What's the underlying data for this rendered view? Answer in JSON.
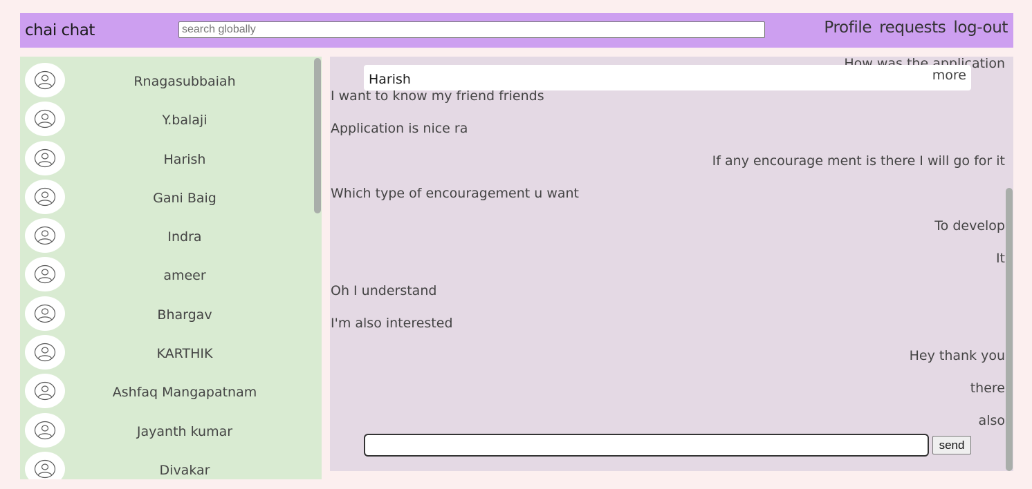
{
  "header": {
    "title": "chai chat",
    "search_placeholder": "search globally",
    "nav": [
      "Profile",
      "requests",
      "log-out"
    ]
  },
  "contacts": [
    "Rnagasubbaiah",
    "Y.balaji",
    "Harish",
    "Gani Baig",
    "Indra",
    "ameer",
    "Bhargav",
    "KARTHIK",
    "Ashfaq Mangapatnam",
    "Jayanth kumar",
    "Divakar"
  ],
  "chat": {
    "name": "Harish",
    "more_label": "more",
    "messages": [
      {
        "text": "How was the application",
        "side": "right"
      },
      {
        "text": "I want to know my friend friends",
        "side": "left"
      },
      {
        "text": "Application is nice ra",
        "side": "left"
      },
      {
        "text": "If any encourage ment is there I will go for it",
        "side": "right"
      },
      {
        "text": "Which type of encouragement u want",
        "side": "left"
      },
      {
        "text": "To develop",
        "side": "right"
      },
      {
        "text": "It",
        "side": "right"
      },
      {
        "text": "Oh I understand",
        "side": "left"
      },
      {
        "text": "I'm also interested",
        "side": "left"
      },
      {
        "text": "Hey thank you",
        "side": "right"
      },
      {
        "text": "there",
        "side": "right"
      },
      {
        "text": "also",
        "side": "right"
      }
    ],
    "input_value": "",
    "send_label": "send"
  }
}
